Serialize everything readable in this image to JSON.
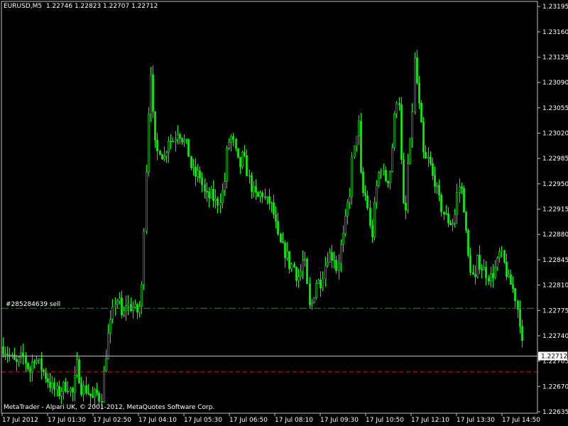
{
  "header": {
    "symbol": "EURUSD,M5",
    "ohlc": "1.22746 1.22823 1.22707 1.22712"
  },
  "footer": {
    "copyright": "MetaTrader - Alpari UK, © 2001-2012, MetaQuotes Software Corp."
  },
  "colors": {
    "background": "#000000",
    "candle": "#00ff00",
    "axis": "#c0c0c0",
    "bid_line": "#c0c0c0",
    "order_line": "#2e8b2e",
    "stop_line": "#ff0000"
  },
  "chart_data": {
    "type": "candlestick",
    "symbol": "EURUSD",
    "timeframe": "M5",
    "price_axis_labels": [
      "1.23195",
      "1.23160",
      "1.23125",
      "1.23090",
      "1.23055",
      "1.23020",
      "1.22985",
      "1.22950",
      "1.22915",
      "1.22880",
      "1.22845",
      "1.22810",
      "1.22775",
      "1.22740",
      "1.22705",
      "1.22670",
      "1.22635"
    ],
    "ylim": [
      1.22633,
      1.23202
    ],
    "time_axis_labels": [
      "17 Jul 2012",
      "17 Jul 01:30",
      "17 Jul 02:50",
      "17 Jul 04:10",
      "17 Jul 05:30",
      "17 Jul 06:50",
      "17 Jul 08:10",
      "17 Jul 09:30",
      "17 Jul 10:50",
      "17 Jul 12:10",
      "17 Jul 13:30",
      "17 Jul 14:50"
    ],
    "current_price": "1.22712",
    "order_line": {
      "label": "#285284639 sell",
      "price": 1.22778
    },
    "stop_line": {
      "price": 1.2269
    },
    "close_path": [
      [
        0,
        1.22725
      ],
      [
        10,
        1.22715
      ],
      [
        20,
        1.227
      ],
      [
        30,
        1.22712
      ],
      [
        40,
        1.2269
      ],
      [
        45,
        1.22712
      ],
      [
        50,
        1.22705
      ],
      [
        60,
        1.22688
      ],
      [
        70,
        1.2267
      ],
      [
        80,
        1.2266
      ],
      [
        85,
        1.22668
      ],
      [
        92,
        1.22672
      ],
      [
        100,
        1.2266
      ],
      [
        106,
        1.227
      ],
      [
        112,
        1.22668
      ],
      [
        120,
        1.22665
      ],
      [
        128,
        1.22652
      ],
      [
        133,
        1.22662
      ],
      [
        140,
        1.2265
      ],
      [
        145,
        1.227
      ],
      [
        150,
        1.2274
      ],
      [
        155,
        1.22765
      ],
      [
        160,
        1.2279
      ],
      [
        165,
        1.2279
      ],
      [
        170,
        1.2276
      ],
      [
        175,
        1.22785
      ],
      [
        180,
        1.2278
      ],
      [
        186,
        1.2278
      ],
      [
        190,
        1.2277
      ],
      [
        193,
        1.2278
      ],
      [
        196,
        1.2278
      ],
      [
        199,
        1.2284
      ],
      [
        202,
        1.2295
      ],
      [
        205,
        1.2299
      ],
      [
        207,
        1.2306
      ],
      [
        210,
        1.2311
      ],
      [
        212,
        1.2306
      ],
      [
        215,
        1.2301
      ],
      [
        218,
        1.2299
      ],
      [
        222,
        1.23
      ],
      [
        226,
        1.2299
      ],
      [
        230,
        1.22985
      ],
      [
        234,
        1.23015
      ],
      [
        238,
        1.2301
      ],
      [
        242,
        1.2301
      ],
      [
        248,
        1.23025
      ],
      [
        256,
        1.2301
      ],
      [
        262,
        1.23
      ],
      [
        266,
        1.22975
      ],
      [
        270,
        1.22965
      ],
      [
        274,
        1.2296
      ],
      [
        278,
        1.22965
      ],
      [
        282,
        1.2295
      ],
      [
        286,
        1.22935
      ],
      [
        290,
        1.2293
      ],
      [
        296,
        1.22935
      ],
      [
        300,
        1.22925
      ],
      [
        304,
        1.22925
      ],
      [
        310,
        1.22935
      ],
      [
        314,
        1.22955
      ],
      [
        318,
        1.23005
      ],
      [
        324,
        1.23015
      ],
      [
        328,
        1.23
      ],
      [
        332,
        1.2298
      ],
      [
        336,
        1.22975
      ],
      [
        340,
        1.2299
      ],
      [
        346,
        1.22965
      ],
      [
        350,
        1.2295
      ],
      [
        356,
        1.22935
      ],
      [
        362,
        1.2293
      ],
      [
        366,
        1.2294
      ],
      [
        372,
        1.22925
      ],
      [
        378,
        1.22925
      ],
      [
        384,
        1.22905
      ],
      [
        390,
        1.2287
      ],
      [
        396,
        1.2286
      ],
      [
        402,
        1.2285
      ],
      [
        406,
        1.22835
      ],
      [
        410,
        1.2284
      ],
      [
        416,
        1.2282
      ],
      [
        420,
        1.22825
      ],
      [
        426,
        1.2285
      ],
      [
        430,
        1.2281
      ],
      [
        434,
        1.22775
      ],
      [
        438,
        1.2279
      ],
      [
        444,
        1.2282
      ],
      [
        448,
        1.2281
      ],
      [
        452,
        1.22825
      ],
      [
        456,
        1.2284
      ],
      [
        460,
        1.22855
      ],
      [
        464,
        1.2285
      ],
      [
        468,
        1.2285
      ],
      [
        472,
        1.2283
      ],
      [
        478,
        1.22865
      ],
      [
        482,
        1.2288
      ],
      [
        486,
        1.22915
      ],
      [
        490,
        1.22935
      ],
      [
        494,
        1.2299
      ],
      [
        498,
        1.23
      ],
      [
        502,
        1.2305
      ],
      [
        506,
        1.2296
      ],
      [
        510,
        1.2293
      ],
      [
        514,
        1.22935
      ],
      [
        518,
        1.2289
      ],
      [
        522,
        1.2288
      ],
      [
        526,
        1.2293
      ],
      [
        530,
        1.2296
      ],
      [
        534,
        1.22975
      ],
      [
        538,
        1.2296
      ],
      [
        542,
        1.22955
      ],
      [
        546,
        1.2296
      ],
      [
        550,
        1.23
      ],
      [
        554,
        1.2305
      ],
      [
        558,
        1.2308
      ],
      [
        560,
        1.2306
      ],
      [
        564,
        1.2294
      ],
      [
        568,
        1.2289
      ],
      [
        572,
        1.22975
      ],
      [
        576,
        1.2301
      ],
      [
        580,
        1.2308
      ],
      [
        582,
        1.2313
      ],
      [
        586,
        1.2307
      ],
      [
        590,
        1.2304
      ],
      [
        594,
        1.2299
      ],
      [
        598,
        1.2298
      ],
      [
        602,
        1.22985
      ],
      [
        606,
        1.2296
      ],
      [
        610,
        1.22955
      ],
      [
        614,
        1.22935
      ],
      [
        618,
        1.2292
      ],
      [
        622,
        1.2291
      ],
      [
        628,
        1.229
      ],
      [
        634,
        1.22895
      ],
      [
        638,
        1.22905
      ],
      [
        642,
        1.2294
      ],
      [
        646,
        1.2295
      ],
      [
        650,
        1.2293
      ],
      [
        654,
        1.2288
      ],
      [
        658,
        1.2284
      ],
      [
        662,
        1.2283
      ],
      [
        666,
        1.2281
      ],
      [
        670,
        1.22845
      ],
      [
        676,
        1.22835
      ],
      [
        680,
        1.2283
      ],
      [
        684,
        1.22825
      ],
      [
        688,
        1.2282
      ],
      [
        694,
        1.2283
      ],
      [
        698,
        1.2284
      ],
      [
        702,
        1.22855
      ],
      [
        706,
        1.22845
      ],
      [
        710,
        1.2283
      ],
      [
        714,
        1.22815
      ],
      [
        718,
        1.2281
      ],
      [
        722,
        1.228
      ],
      [
        726,
        1.2278
      ],
      [
        730,
        1.2276
      ],
      [
        734,
        1.22712
      ]
    ]
  }
}
